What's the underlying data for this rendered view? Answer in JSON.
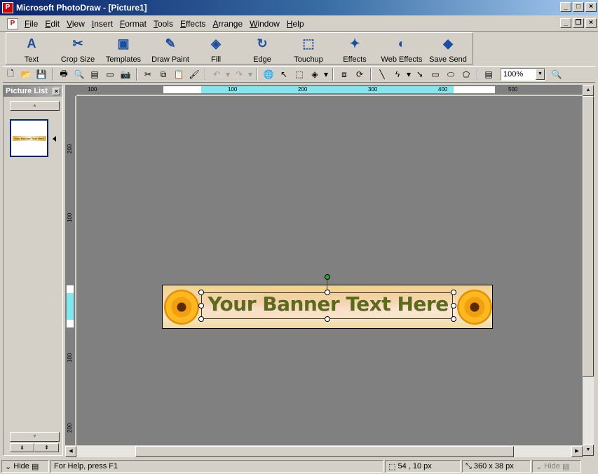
{
  "window": {
    "title": "Microsoft PhotoDraw - [Picture1]",
    "app_icon": "photodraw-icon"
  },
  "menu": [
    "File",
    "Edit",
    "View",
    "Insert",
    "Format",
    "Tools",
    "Effects",
    "Arrange",
    "Window",
    "Help"
  ],
  "big_toolbar": [
    {
      "label": "Text",
      "icon": "text-tool-icon"
    },
    {
      "label": "Crop Size",
      "icon": "crop-icon"
    },
    {
      "label": "Templates",
      "icon": "templates-icon"
    },
    {
      "label": "Draw Paint",
      "icon": "draw-paint-icon"
    },
    {
      "label": "Fill",
      "icon": "fill-icon"
    },
    {
      "label": "Edge",
      "icon": "edge-icon"
    },
    {
      "label": "Touchup",
      "icon": "touchup-icon"
    },
    {
      "label": "Effects",
      "icon": "effects-icon"
    },
    {
      "label": "Web Effects",
      "icon": "web-effects-icon"
    },
    {
      "label": "Save Send",
      "icon": "save-send-icon"
    }
  ],
  "zoom": {
    "value": "100%"
  },
  "picture_list": {
    "title": "Picture List",
    "thumbnail_text": "Your Banner Text Here"
  },
  "ruler": {
    "h_labels": [
      "100",
      "100",
      "200",
      "300",
      "400",
      "500"
    ],
    "v_labels": [
      "200",
      "100",
      "100",
      "200"
    ]
  },
  "banner": {
    "text": "Your Banner Text Here"
  },
  "status": {
    "hide_left": "Hide",
    "help": "For Help, press F1",
    "position": "54 , 10  px",
    "size": "360 x 38  px",
    "hide_right": "Hide"
  },
  "colors": {
    "title_start": "#0a246a",
    "canvas": "#808080",
    "banner_text": "#5c6a1e",
    "ruler_highlight": "#7ee8ee"
  }
}
